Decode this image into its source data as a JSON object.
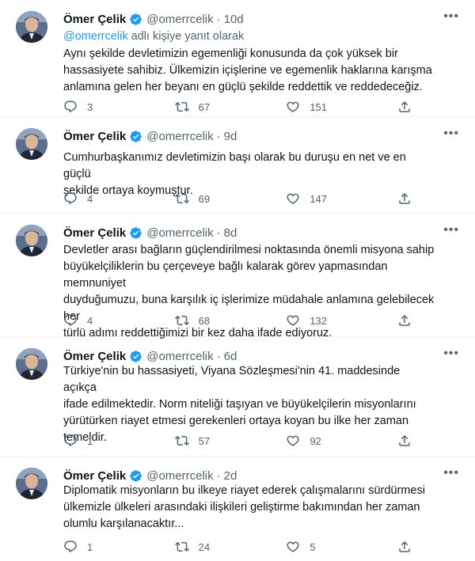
{
  "tweets": [
    {
      "name": "Ömer Çelik",
      "handle": "@omerrcelik",
      "separator": "·",
      "time": "10d",
      "reply_to": {
        "mention": "@omerrcelik",
        "suffix": " adlı kişiye yanıt olarak"
      },
      "text": "Aynı şekilde devletimizin egemenliği konusunda da çok yüksek bir\nhassasiyete sahibiz. Ülkemizin içişlerine ve egemenlik haklarına karışma\nanlamına gelen her beyanı en güçlü şekilde reddettik ve reddedeceğiz.",
      "replies": "3",
      "retweets": "67",
      "likes": "151"
    },
    {
      "name": "Ömer Çelik",
      "handle": "@omerrcelik",
      "separator": "·",
      "time": "9d",
      "text": "Cumhurbaşkanımız devletimizin başı olarak bu duruşu en net ve en güçlü\nşekilde ortaya koymuştur.",
      "replies": "4",
      "retweets": "69",
      "likes": "147"
    },
    {
      "name": "Ömer Çelik",
      "handle": "@omerrcelik",
      "separator": "·",
      "time": "8d",
      "text": "Devletler arası bağların güçlendirilmesi noktasında önemli misyona sahip\nbüyükelçiliklerin bu çerçeveye bağlı kalarak görev yapmasından memnuniyet\nduyduğumuzu, buna karşılık iç işlerimize müdahale anlamına gelebilecek her\ntürlü adımı reddettiğimizi bir kez daha ifade ediyoruz.",
      "replies": "4",
      "retweets": "68",
      "likes": "132"
    },
    {
      "name": "Ömer Çelik",
      "handle": "@omerrcelik",
      "separator": "·",
      "time": "6d",
      "text": "Türkiye'nin bu hassasiyeti, Viyana Sözleşmesi'nin 41. maddesinde açıkça\nifade edilmektedir. Norm niteliği taşıyan ve büyükelçilerin misyonlarını\nyürütürken riayet etmesi gerekenleri ortaya koyan bu ilke her zaman\ntemeldir.",
      "replies": "1",
      "retweets": "57",
      "likes": "92"
    },
    {
      "name": "Ömer Çelik",
      "handle": "@omerrcelik",
      "separator": "·",
      "time": "2d",
      "text": "Diplomatik misyonların bu ilkeye riayet ederek çalışmalarını sürdürmesi\nülkemizle ülkeleri arasındaki ilişkileri geliştirme bakımından her zaman\nolumlu karşılanacaktır...",
      "replies": "1",
      "retweets": "24",
      "likes": "5"
    }
  ],
  "icons": {
    "verified": "verified-badge-icon",
    "reply": "reply-icon",
    "retweet": "retweet-icon",
    "like": "heart-icon",
    "share": "share-icon",
    "more": "more-icon"
  },
  "colors": {
    "verified": "#1d9bf0",
    "mention": "#1d9bf0",
    "secondary_text": "#536471",
    "primary_text": "#0f1419"
  }
}
